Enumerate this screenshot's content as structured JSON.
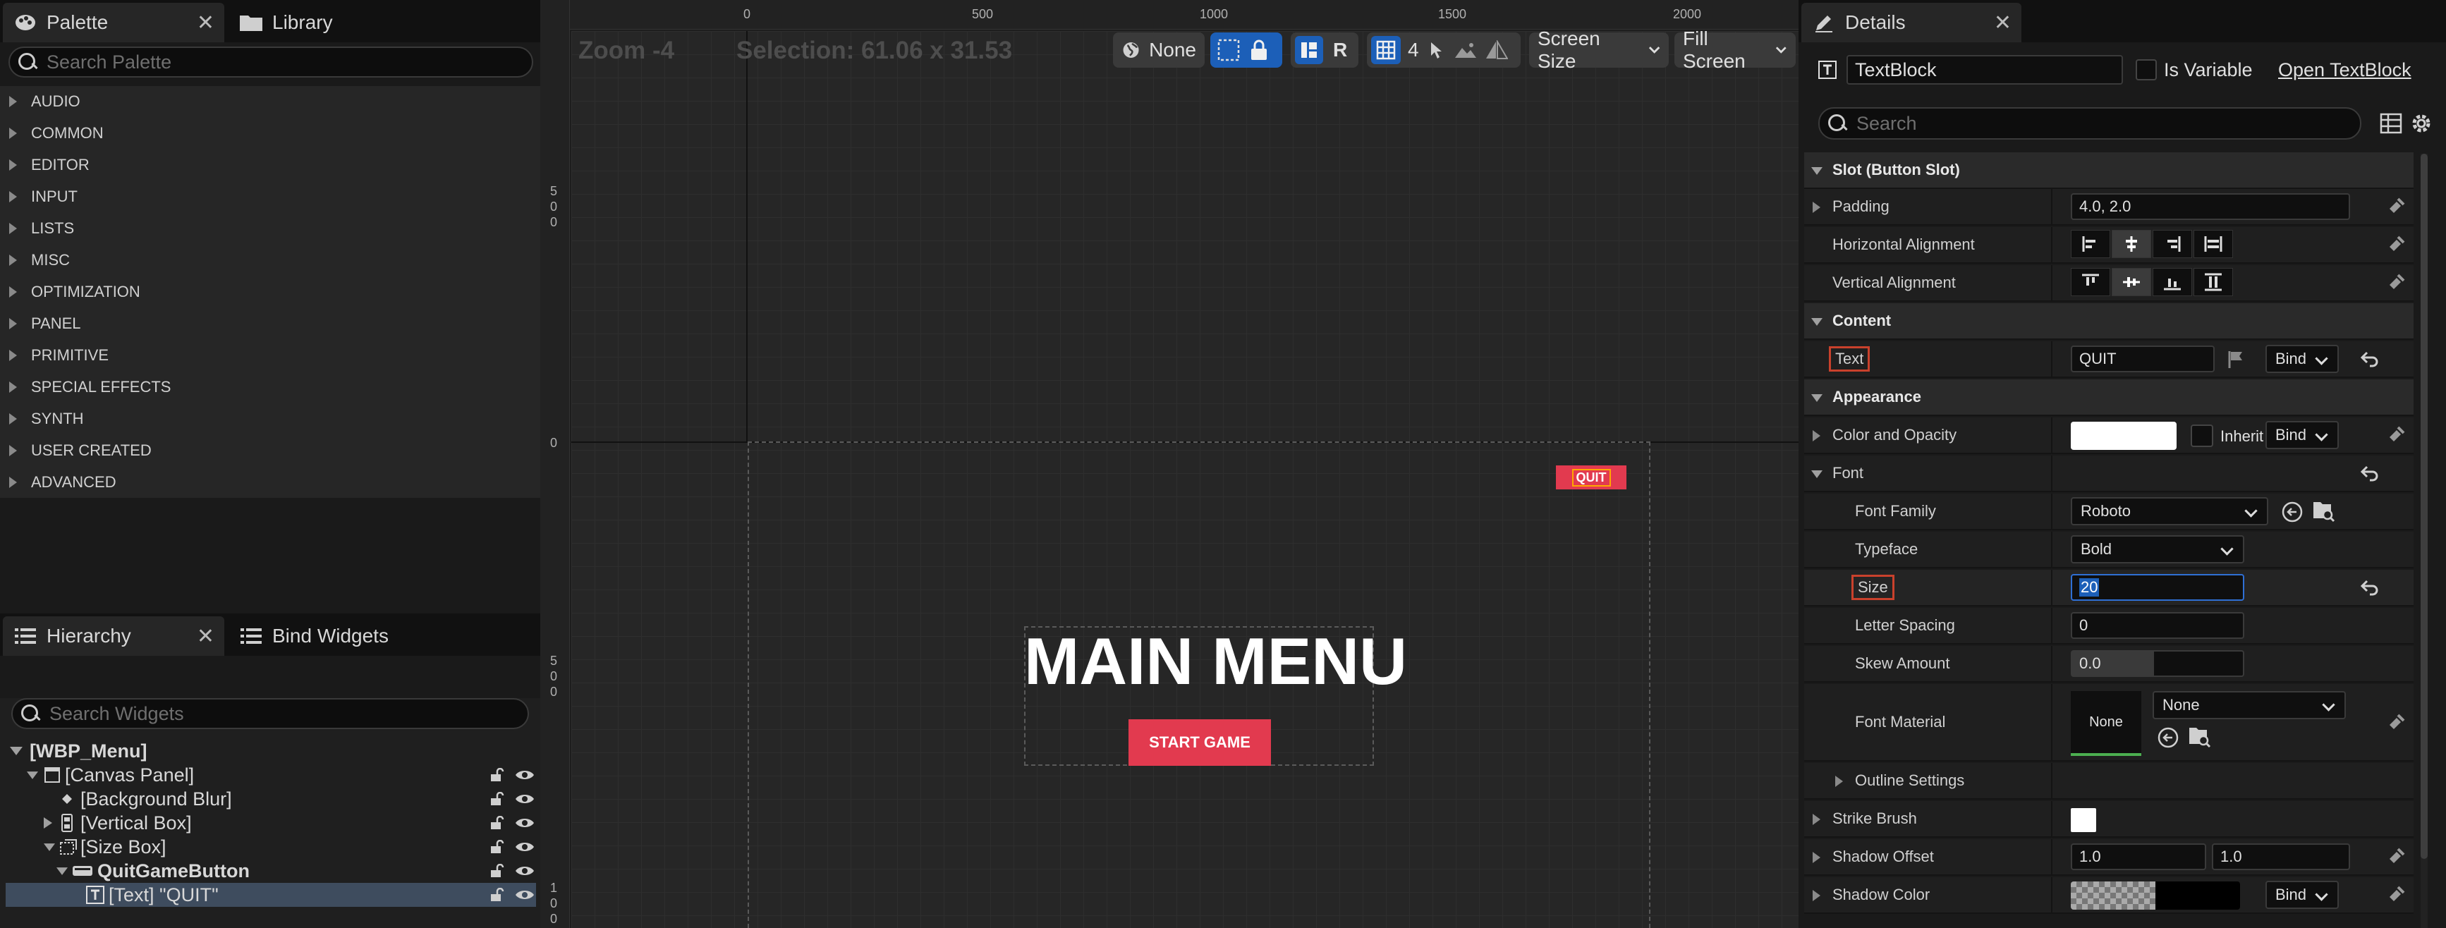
{
  "palette": {
    "tab_label": "Palette",
    "library_tab_label": "Library",
    "search_placeholder": "Search Palette",
    "categories": [
      "AUDIO",
      "COMMON",
      "EDITOR",
      "INPUT",
      "LISTS",
      "MISC",
      "OPTIMIZATION",
      "PANEL",
      "PRIMITIVE",
      "SPECIAL EFFECTS",
      "SYNTH",
      "USER CREATED",
      "ADVANCED"
    ]
  },
  "hierarchy": {
    "tab_label": "Hierarchy",
    "bind_tab_label": "Bind Widgets",
    "search_placeholder": "Search Widgets",
    "items": [
      {
        "label": "[WBP_Menu]"
      },
      {
        "label": "[Canvas Panel]"
      },
      {
        "label": "[Background Blur]"
      },
      {
        "label": "[Vertical Box]"
      },
      {
        "label": "[Size Box]"
      },
      {
        "label": "QuitGameButton"
      },
      {
        "label": "[Text] \"QUIT\""
      }
    ]
  },
  "viewport": {
    "zoom": "Zoom -4",
    "selection": "Selection: 61.06 x 31.53",
    "toolbar": {
      "none_label": "None",
      "r_label": "R",
      "grid_value": "4",
      "screen_size": "Screen Size",
      "fill_screen": "Fill Screen"
    },
    "ruler_top": [
      "0",
      "500",
      "1000",
      "1500",
      "2000"
    ],
    "ruler_left": [
      "500",
      "0",
      "500",
      "100"
    ],
    "canvas": {
      "title": "MAIN MENU",
      "start_button": "START GAME",
      "quit_button": "QUIT"
    }
  },
  "details": {
    "tab_label": "Details",
    "name_value": "TextBlock",
    "is_variable_label": "Is Variable",
    "open_link": "Open TextBlock",
    "search_placeholder": "Search",
    "sections": {
      "slot": "Slot (Button Slot)",
      "content": "Content",
      "appearance": "Appearance"
    },
    "padding": {
      "label": "Padding",
      "value": "4.0, 2.0"
    },
    "h_align": {
      "label": "Horizontal Alignment"
    },
    "v_align": {
      "label": "Vertical Alignment"
    },
    "text": {
      "label": "Text",
      "value": "QUIT",
      "bind": "Bind"
    },
    "color": {
      "label": "Color and Opacity",
      "inherit": "Inherit",
      "bind": "Bind"
    },
    "font": {
      "label": "Font",
      "family_label": "Font Family",
      "family": "Roboto",
      "typeface_label": "Typeface",
      "typeface": "Bold",
      "size_label": "Size",
      "size": "20",
      "spacing_label": "Letter Spacing",
      "spacing": "0",
      "skew_label": "Skew Amount",
      "skew": "0.0",
      "material_label": "Font Material",
      "material_thumb": "None",
      "material_value": "None",
      "outline_label": "Outline Settings"
    },
    "strike_label": "Strike Brush",
    "shadow_offset": {
      "label": "Shadow Offset",
      "x": "1.0",
      "y": "1.0"
    },
    "shadow_color": {
      "label": "Shadow Color",
      "bind": "Bind"
    }
  },
  "colors": {
    "accent_red": "#e23a4f",
    "accent_blue": "#1c5fb8",
    "highlight_border": "#c9412c"
  }
}
